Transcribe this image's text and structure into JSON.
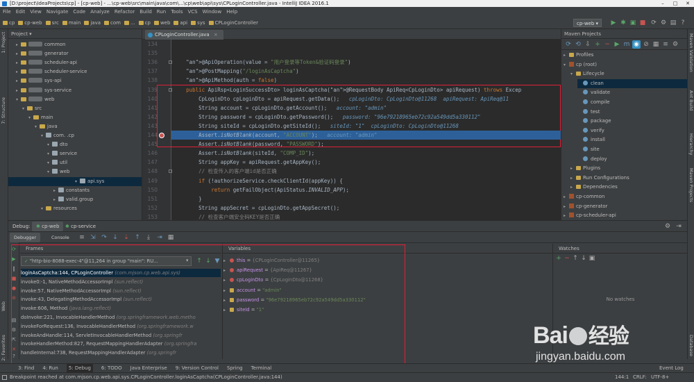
{
  "window": {
    "title": "[D:\\project\\IdeaProjects\\cp] - [cp-web] - ...\\cp-web\\src\\main\\java\\com\\...\\cp\\web\\api\\sys\\CPLoginController.java - IntelliJ IDEA 2016.1",
    "minimize": "–",
    "maximize": "□",
    "close": "✕"
  },
  "menu": [
    "File",
    "Edit",
    "View",
    "Navigate",
    "Code",
    "Analyze",
    "Refactor",
    "Build",
    "Run",
    "Tools",
    "VCS",
    "Window",
    "Help"
  ],
  "breadcrumbs": [
    "cp",
    "cp-web",
    "src",
    "main",
    "java",
    "com",
    "...",
    "cp",
    "web",
    "api",
    "sys",
    "CPLoginController"
  ],
  "run_config": "cp-web",
  "project_panel": {
    "title": "Project",
    "items": [
      {
        "label": "common",
        "indent": 1
      },
      {
        "label": "generator",
        "indent": 1
      },
      {
        "label": "scheduler-api",
        "indent": 1
      },
      {
        "label": "scheduler-service",
        "indent": 1
      },
      {
        "label": "sys-api",
        "indent": 1
      },
      {
        "label": "sys-service",
        "indent": 1
      },
      {
        "label": "web",
        "indent": 1
      },
      {
        "label": "src",
        "indent": 2
      },
      {
        "label": "main",
        "indent": 3
      },
      {
        "label": "java",
        "indent": 4
      },
      {
        "label": "com.     .cp",
        "indent": 5
      },
      {
        "label": "dto",
        "indent": 6
      },
      {
        "label": "service",
        "indent": 6
      },
      {
        "label": "util",
        "indent": 6
      },
      {
        "label": "web",
        "indent": 6
      },
      {
        "label": "api.sys",
        "indent": 7
      },
      {
        "label": "constants",
        "indent": 7
      },
      {
        "label": "valid.group",
        "indent": 7
      },
      {
        "label": "resources",
        "indent": 5
      }
    ]
  },
  "editor": {
    "tab": "CPLoginController.java",
    "line_numbers": [
      "134",
      "135",
      "136",
      "137",
      "138",
      "139",
      "140",
      "141",
      "142",
      "143",
      "144",
      "145",
      "146",
      "147",
      "148",
      "149",
      "150",
      "151",
      "152",
      "153"
    ],
    "code": [
      "",
      "",
      "    @ApiOperation(value = \"用户登录等Token&验证码登录\")",
      "    @PostMapping(\"/loginAsCaptcha\")",
      "    @ApiMethod(auth = false)",
      "    public ApiRsp<LoginSuccessDto> loginAsCaptcha(@RequestBody ApiReq<CpLoginDto> apiRequest) throws Excep",
      "        CpLoginDto cpLoginDto = apiRequest.getData();   cpLoginDto: CpLoginDto@11268  apiRequest: ApiReq@11",
      "        String account = cpLoginDto.getAccount();   account: \"admin\"",
      "        String password = cpLoginDto.getPassword();   password: \"96e79218965eb72c92a549dd5a330112\"",
      "        String siteId = cpLoginDto.getSiteId();   siteId: \"1\"  cpLoginDto: CpLoginDto@11268",
      "        Assert.isNotBlank(account, \"ACCOUNT\");   account: \"admin\"",
      "        Assert.isNotBlank(password, \"PASSWORD\");",
      "        Assert.isNotBlank(siteId, \"COMP_ID\");",
      "        String appKey = apiRequest.getAppKey();",
      "        // 检查传入的客户端id是否正确",
      "        if (!authorizeService.checkClientId(appKey)) {",
      "            return getFailObject(ApiStatus.INVALID_APP);",
      "        }",
      "        String appSecret = cpLoginDto.getAppSecret();",
      "        // 检查客户端安全码KEY是否正确"
    ]
  },
  "maven": {
    "title": "Maven Projects",
    "items": [
      {
        "label": "Profiles",
        "indent": 0,
        "kind": "folder"
      },
      {
        "label": "cp (root)",
        "indent": 0,
        "kind": "maven"
      },
      {
        "label": "Lifecycle",
        "indent": 1,
        "kind": "folder"
      },
      {
        "label": "clean",
        "indent": 2,
        "kind": "goal"
      },
      {
        "label": "validate",
        "indent": 2,
        "kind": "goal"
      },
      {
        "label": "compile",
        "indent": 2,
        "kind": "goal"
      },
      {
        "label": "test",
        "indent": 2,
        "kind": "goal"
      },
      {
        "label": "package",
        "indent": 2,
        "kind": "goal"
      },
      {
        "label": "verify",
        "indent": 2,
        "kind": "goal"
      },
      {
        "label": "install",
        "indent": 2,
        "kind": "goal"
      },
      {
        "label": "site",
        "indent": 2,
        "kind": "goal"
      },
      {
        "label": "deploy",
        "indent": 2,
        "kind": "goal"
      },
      {
        "label": "Plugins",
        "indent": 1,
        "kind": "folder"
      },
      {
        "label": "Run Configurations",
        "indent": 1,
        "kind": "folder"
      },
      {
        "label": "Dependencies",
        "indent": 1,
        "kind": "folder"
      },
      {
        "label": "cp-common",
        "indent": 0,
        "kind": "maven"
      },
      {
        "label": "cp-generator",
        "indent": 0,
        "kind": "maven"
      },
      {
        "label": "cp-scheduler-api",
        "indent": 0,
        "kind": "maven"
      }
    ]
  },
  "debug": {
    "label": "Debug:",
    "sessions": [
      "cp-web",
      "cp-service"
    ],
    "subtabs": [
      "Debugger",
      "Console"
    ],
    "frames_title": "Frames",
    "thread": "\"http-bio-8088-exec-4\"@11,264 in group \"main\": RU...",
    "frames": [
      {
        "method": "loginAsCaptcha:144, CPLoginController",
        "pkg": "(com.mjson.cp.web.api.sys)"
      },
      {
        "method": "invoke0:-1, NativeMethodAccessorImpl",
        "pkg": "(sun.reflect)"
      },
      {
        "method": "invoke:57, NativeMethodAccessorImpl",
        "pkg": "(sun.reflect)"
      },
      {
        "method": "invoke:43, DelegatingMethodAccessorImpl",
        "pkg": "(sun.reflect)"
      },
      {
        "method": "invoke:606, Method",
        "pkg": "(java.lang.reflect)"
      },
      {
        "method": "doInvoke:221, InvocableHandlerMethod",
        "pkg": "(org.springframework.web.metho"
      },
      {
        "method": "invokeForRequest:136, InvocableHandlerMethod",
        "pkg": "(org.springframework.w"
      },
      {
        "method": "invokeAndHandle:114, ServletInvocableHandlerMethod",
        "pkg": "(org.springfr"
      },
      {
        "method": "invokeHandlerMethod:827, RequestMappingHandlerAdapter",
        "pkg": "(org.springfra"
      },
      {
        "method": "handleInternal:738, RequestMappingHandlerAdapter",
        "pkg": "(org.springfr"
      }
    ],
    "variables_title": "Variables",
    "variables": [
      {
        "name": "this",
        "value": "{CPLoginController@11265}",
        "kind": "obj"
      },
      {
        "name": "apiRequest",
        "value": "{ApiReq@11267}",
        "kind": "obj"
      },
      {
        "name": "cpLoginDto",
        "value": "{CpLoginDto@11268}",
        "kind": "obj"
      },
      {
        "name": "account",
        "value": "\"admin\"",
        "kind": "str"
      },
      {
        "name": "password",
        "value": "\"96e79218965eb72c92a549dd5a330112\"",
        "kind": "str"
      },
      {
        "name": "siteId",
        "value": "\"1\"",
        "kind": "str"
      }
    ],
    "watches_title": "Watches",
    "no_watches": "No watches"
  },
  "bottom_tabs": [
    "3: Find",
    "4: Run",
    "5: Debug",
    "6: TODO",
    "Java Enterprise",
    "9: Version Control",
    "Spring",
    "Terminal"
  ],
  "event_log": "Event Log",
  "status": {
    "message": "Breakpoint reached at com.mjson.cp.web.api.sys.CPLoginController.loginAsCaptcha(CPLoginController.java:144)",
    "position": "144:1",
    "line_sep": "CRLF:",
    "encoding": "UTF-8+"
  },
  "side_labels": {
    "left": [
      "1: Project",
      "7: Structure",
      "2: Favorites",
      "Web"
    ],
    "right": [
      "Maven Validation",
      "Ant Build",
      "Hierarchy",
      "Maven Projects",
      "Database"
    ]
  },
  "watermark": {
    "brand": "Bai",
    "brand2": "经验",
    "url": "jingyan.baidu.com"
  },
  "colors": {
    "highlight": "#2d6099",
    "annotation_box": "#e0203a",
    "selection": "#0d293e"
  }
}
